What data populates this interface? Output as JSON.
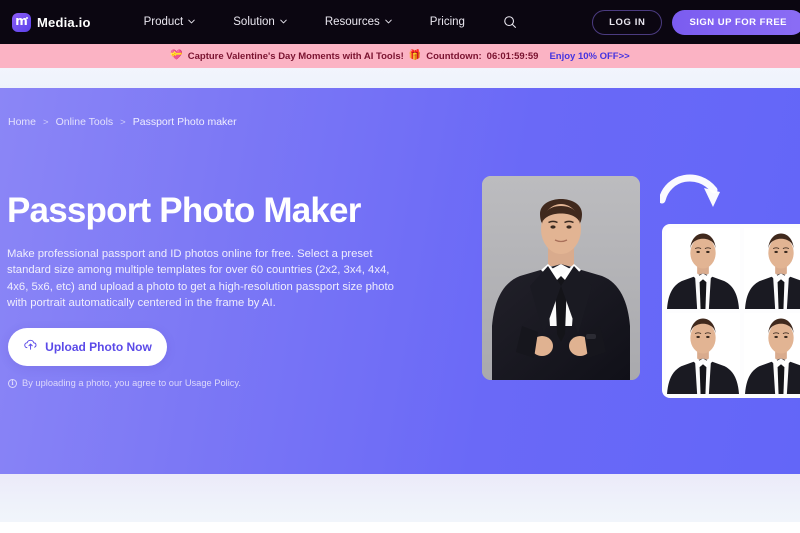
{
  "header": {
    "logo_text": "Media.io",
    "logo_icon": "media-io-logo-icon",
    "nav": [
      {
        "label": "Product",
        "has_dropdown": true
      },
      {
        "label": "Solution",
        "has_dropdown": true
      },
      {
        "label": "Resources",
        "has_dropdown": true
      },
      {
        "label": "Pricing",
        "has_dropdown": false
      }
    ],
    "search_icon": "search-icon",
    "login_label": "LOG IN",
    "signup_label": "SIGN UP FOR FREE",
    "background_color": "#0b0611",
    "signup_color": "#7b5cf0"
  },
  "promo": {
    "heart_emoji": "💝",
    "message": "Capture Valentine's Day Moments with AI Tools!",
    "gift_emoji": "🎁",
    "countdown_label": "Countdown:",
    "countdown_value": "06:01:59:59",
    "link_label": "Enjoy 10% OFF>>",
    "background_color": "#fbb3c4",
    "text_color": "#7a1330",
    "link_color": "#4433e0"
  },
  "breadcrumb": {
    "items": [
      "Home",
      "Online Tools",
      "Passport Photo maker"
    ],
    "separator": ">"
  },
  "hero": {
    "title": "Passport Photo Maker",
    "description": "Make professional passport and ID photos online for free. Select a preset standard size among multiple templates for over 60 countries (2x2, 3x4, 4x4, 4x6, 5x6, etc) and upload a photo to get a high-resolution passport size photo with portrait automatically centered in the frame by AI.",
    "upload_button_label": "Upload Photo Now",
    "upload_button_icon": "cloud-upload-icon",
    "policy_icon": "info-icon",
    "policy_text": "By uploading a photo, you agree to our Usage Policy.",
    "gradient_start": "#8b86f6",
    "gradient_end": "#6366f8",
    "original_photo_alt": "man-in-suit-original-photo",
    "result_photos_alt": "passport-photo-grid-result",
    "arrow_icon": "curved-arrow-icon"
  }
}
